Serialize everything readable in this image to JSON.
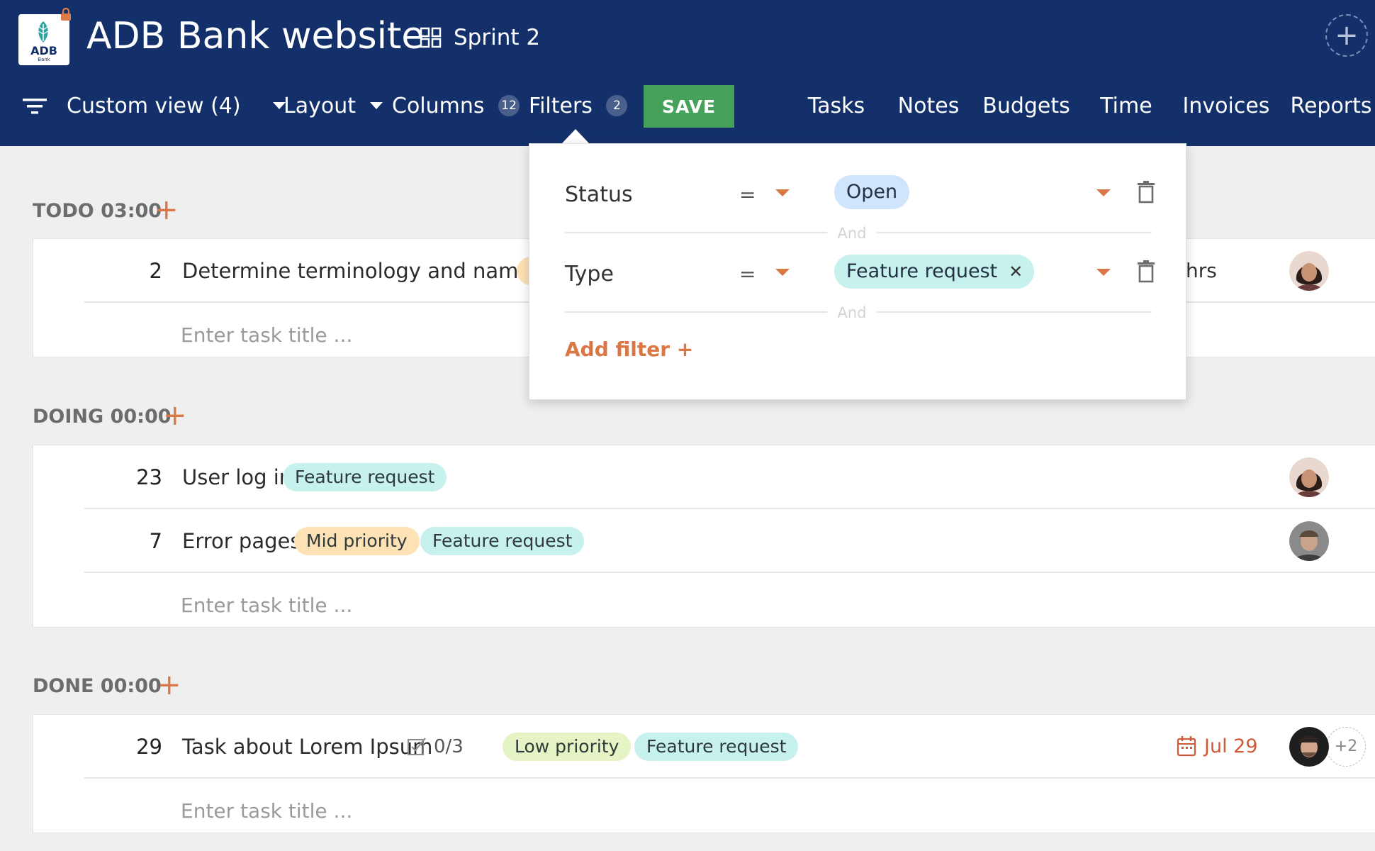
{
  "header": {
    "logo_text": "ADB",
    "logo_sub": "Bank",
    "title": "ADB Bank website",
    "sprint_label": "Sprint 2"
  },
  "toolbar": {
    "custom_view": "Custom view (4)",
    "layout": "Layout",
    "columns": "Columns",
    "columns_count": "12",
    "filters": "Filters",
    "filters_count": "2",
    "save": "SAVE"
  },
  "nav": {
    "tabs": [
      {
        "label": "Tasks",
        "active": true
      },
      {
        "label": "Notes"
      },
      {
        "label": "Budgets"
      },
      {
        "label": "Time"
      },
      {
        "label": "Invoices"
      },
      {
        "label": "Reports"
      }
    ]
  },
  "sections": [
    {
      "title": "TODO 03:00",
      "tasks": [
        {
          "number": "2",
          "title": "Determine terminology and names",
          "hours": "hrs"
        }
      ],
      "placeholder": "Enter task title ..."
    },
    {
      "title": "DOING 00:00",
      "tasks": [
        {
          "number": "23",
          "title": "User log in",
          "tags": [
            "Feature request"
          ]
        },
        {
          "number": "7",
          "title": "Error pages",
          "tags": [
            "Mid priority",
            "Feature request"
          ]
        }
      ],
      "placeholder": "Enter task title ..."
    },
    {
      "title": "DONE 00:00",
      "tasks": [
        {
          "number": "29",
          "title": "Task about Lorem Ipsum",
          "checklist": "0/3",
          "tags": [
            "Low priority",
            "Feature request"
          ],
          "due": "Jul 29",
          "more_assignees": "+2"
        }
      ],
      "placeholder": "Enter task title ..."
    }
  ],
  "filter_popover": {
    "rows": [
      {
        "field": "Status",
        "operator": "=",
        "value": "Open"
      },
      {
        "field": "Type",
        "operator": "=",
        "value": "Feature request"
      }
    ],
    "and_label": "And",
    "add_filter": "Add filter +"
  },
  "colors": {
    "header_bg": "#13306a",
    "accent": "#d97746",
    "save_green": "#46a15a",
    "tag_feature": "#c6f1ec",
    "tag_mid": "#fde2b6",
    "tag_low": "#e6f3c4",
    "pill_open": "#cfe5fb"
  }
}
